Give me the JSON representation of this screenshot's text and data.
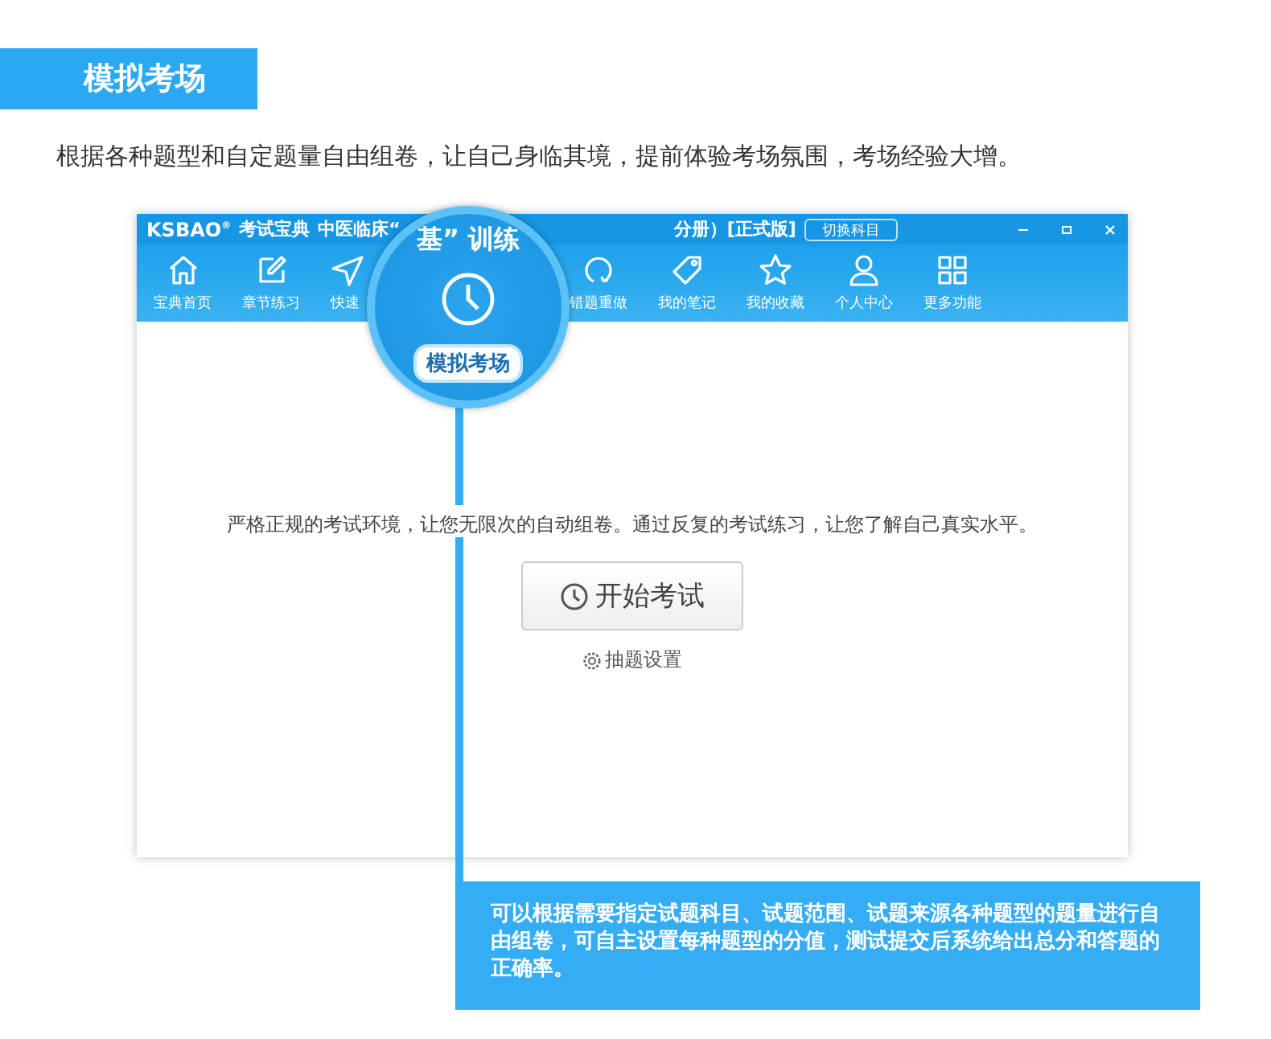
{
  "banner": {
    "title": "模拟考场"
  },
  "subtitle": "根据各种题型和自定题量自由组卷，让自己身临其境，提前体验考场氛围，考场经验大增。",
  "app": {
    "logo": "KSBAO",
    "logo_mark": "®",
    "brand": "考试宝典",
    "title_left": "中医临床“",
    "title_right": "分册）[正式版]",
    "switch_button": "切换科目",
    "toolbar_left": [
      {
        "kind": "home",
        "label": "宝典首页"
      },
      {
        "kind": "edit",
        "label": "章节练习"
      },
      {
        "kind": "send",
        "label": "快速"
      }
    ],
    "toolbar_right": [
      {
        "kind": "refresh",
        "label": "错题重做"
      },
      {
        "kind": "tag",
        "label": "我的笔记"
      },
      {
        "kind": "star",
        "label": "我的收藏"
      },
      {
        "kind": "user",
        "label": "个人中心"
      },
      {
        "kind": "grid",
        "label": "更多功能"
      }
    ],
    "intro": "严格正规的考试环境，让您无限次的自动组卷。通过反复的考试练习，让您了解自己真实水平。",
    "start_button": "开始考试",
    "settings_link": "抽题设置"
  },
  "magnifier": {
    "title_fragment": "基” 训练",
    "label": "模拟考场"
  },
  "callout": "可以根据需要指定试题科目、试题范围、试题来源各种题型的题量进行自由组卷，可自主设置每种题型的分值，测试提交后系统给出总分和答题的正确率。"
}
